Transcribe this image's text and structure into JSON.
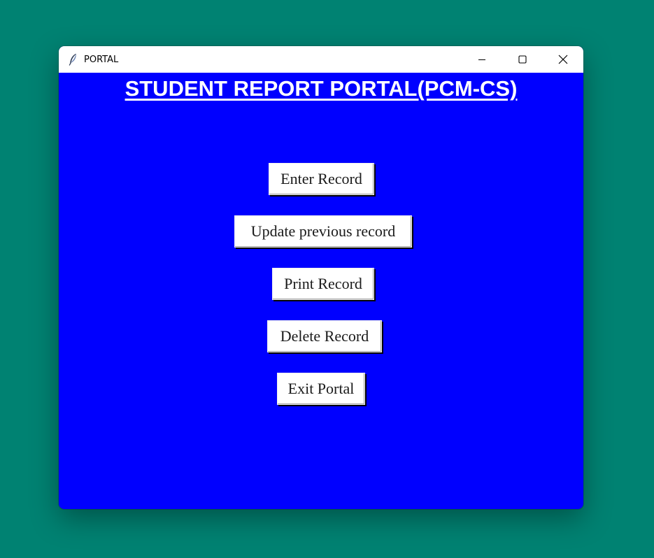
{
  "window": {
    "title": "PORTAL",
    "icon": "feather-icon",
    "controls": [
      "minimize-icon",
      "maximize-icon",
      "close-icon"
    ]
  },
  "main": {
    "heading": "STUDENT REPORT PORTAL(PCM-CS)",
    "buttons": {
      "enter": "Enter Record",
      "update": "Update previous record",
      "print": "Print Record",
      "delete": "Delete Record",
      "exit": "Exit Portal"
    }
  },
  "colors": {
    "desktop": "#008272",
    "content_background": "#0000ff",
    "heading_text": "#ffffff",
    "button_background": "#ffffff"
  }
}
